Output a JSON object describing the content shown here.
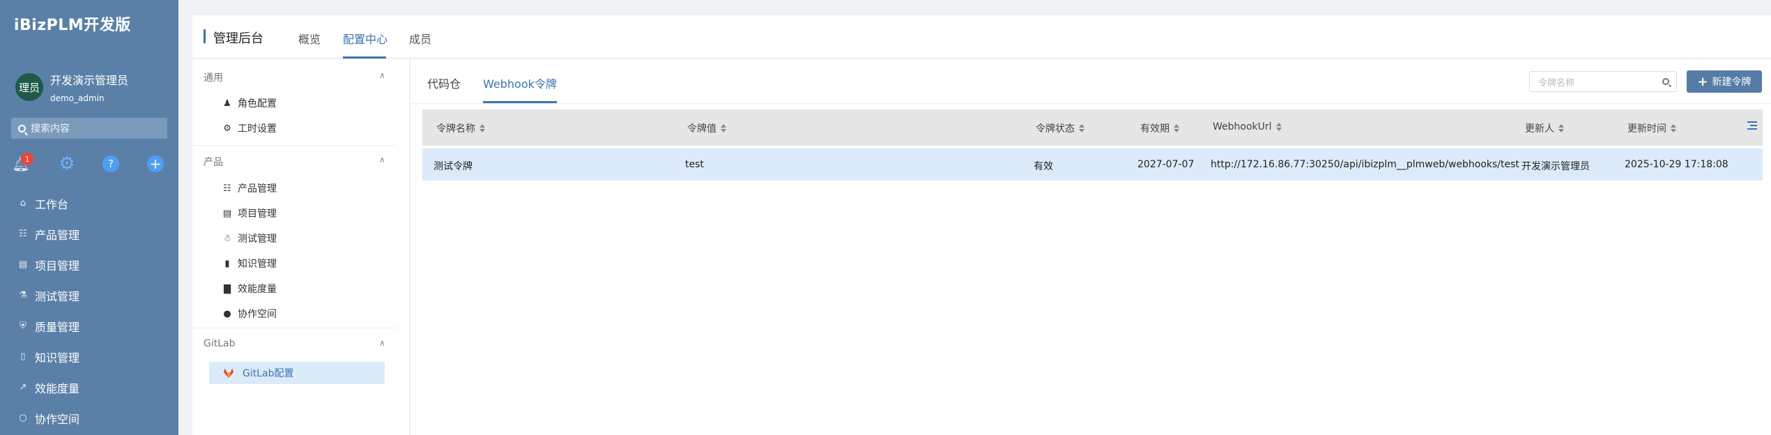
{
  "sidebar": {
    "brand": "iBizPLM开发版",
    "user": {
      "avatar": "理员",
      "name": "开发演示管理员",
      "id": "demo_admin"
    },
    "search_placeholder": "搜索内容",
    "notifications_badge": "1",
    "quick_actions": {
      "help": "?",
      "add": "+"
    },
    "nav": [
      {
        "label": "工作台",
        "icon": "home-icon"
      },
      {
        "label": "产品管理",
        "icon": "grid-icon"
      },
      {
        "label": "项目管理",
        "icon": "folder-icon"
      },
      {
        "label": "测试管理",
        "icon": "flask-icon"
      },
      {
        "label": "质量管理",
        "icon": "shield-icon"
      },
      {
        "label": "知识管理",
        "icon": "book-icon"
      },
      {
        "label": "效能度量",
        "icon": "chart-icon"
      },
      {
        "label": "协作空间",
        "icon": "chat-icon"
      }
    ]
  },
  "topbar": {
    "title": "管理后台",
    "tabs": [
      {
        "label": "概览"
      },
      {
        "label": "配置中心"
      },
      {
        "label": "成员"
      }
    ],
    "active_tab": "配置中心"
  },
  "config_panel": {
    "groups": [
      {
        "title": "通用",
        "items": [
          {
            "label": "角色配置",
            "icon": "users-icon"
          },
          {
            "label": "工时设置",
            "icon": "gear-icon"
          }
        ]
      },
      {
        "title": "产品",
        "items": [
          {
            "label": "产品管理",
            "icon": "grid-icon"
          },
          {
            "label": "项目管理",
            "icon": "file-icon"
          },
          {
            "label": "测试管理",
            "icon": "bug-icon"
          },
          {
            "label": "知识管理",
            "icon": "book-icon"
          },
          {
            "label": "效能度量",
            "icon": "bar-chart-icon"
          },
          {
            "label": "协作空间",
            "icon": "chat-icon"
          }
        ]
      },
      {
        "title": "GitLab",
        "items": [
          {
            "label": "GitLab配置",
            "icon": "gitlab-icon",
            "selected": true
          }
        ]
      }
    ]
  },
  "main": {
    "tabs": [
      {
        "label": "代码仓"
      },
      {
        "label": "Webhook令牌"
      }
    ],
    "active_tab": "Webhook令牌",
    "search_placeholder": "令牌名称",
    "new_button": "新建令牌",
    "table": {
      "columns": [
        "令牌名称",
        "令牌值",
        "令牌状态",
        "有效期",
        "WebhookUrl",
        "更新人",
        "更新时间"
      ],
      "rows": [
        [
          "测试令牌",
          "test",
          "有效",
          "2027-07-07",
          "http://172.16.86.77:30250/api/ibizplm__plmweb/webhooks/test",
          "开发演示管理员",
          "2025-10-29 17:18:08"
        ]
      ]
    }
  },
  "colors": {
    "sidebar_bg": "#5b80a8",
    "accent": "#3a73b8",
    "selected_row": "#dcebfa",
    "badge": "#f04134"
  }
}
